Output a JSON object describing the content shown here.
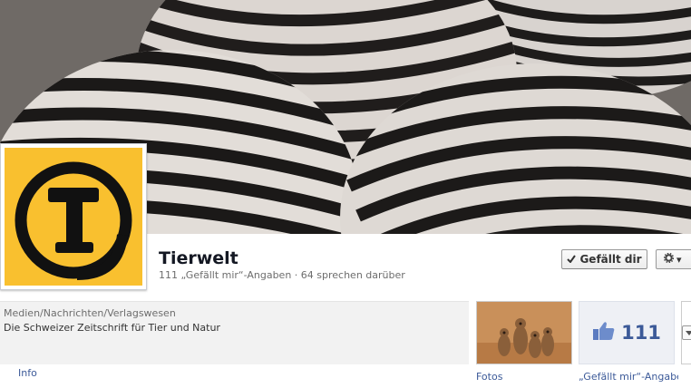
{
  "page": {
    "name": "Tierwelt",
    "stats": "111 „Gefällt mir“-Angaben · 64 sprechen darüber"
  },
  "actions": {
    "like_label": "Gefällt dir",
    "settings_icon": "gear-icon"
  },
  "about": {
    "category": "Medien/Nachrichten/Verlagswesen",
    "description": "Die Schweizer Zeitschrift für Tier und Natur",
    "tab_label": "Info"
  },
  "apps": {
    "photos_label": "Fotos",
    "likes_count": "111",
    "likes_label": "„Gefällt mir“-Angaben",
    "likes_icon": "thumbs-up-icon"
  },
  "colors": {
    "link": "#3b5998",
    "brand_yellow": "#f9c02f"
  }
}
